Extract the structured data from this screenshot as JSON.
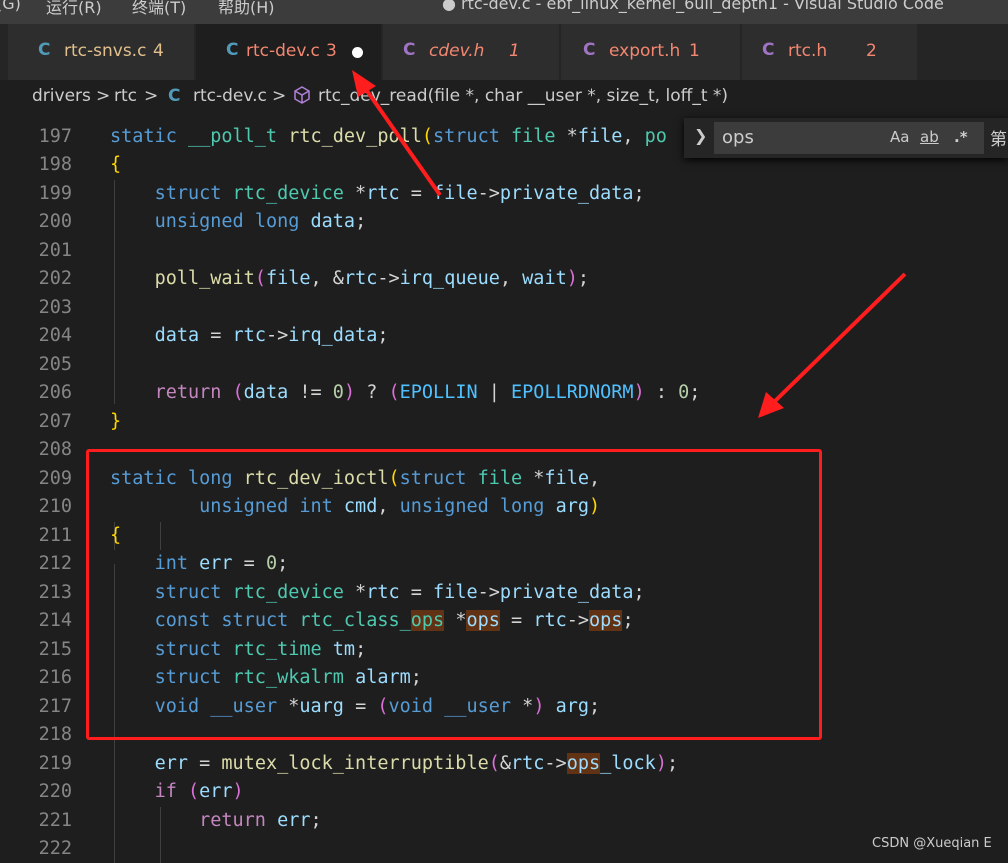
{
  "menubar": {
    "items": [
      "(G)",
      "运行(R)",
      "终端(T)",
      "帮助(H)"
    ],
    "window_title": "● rtc-dev.c - ebf_linux_kernel_6ull_depth1 - Visual Studio Code"
  },
  "tabs": [
    {
      "icon": "C",
      "label": "rtc-snvs.c",
      "count": "4",
      "color": "#e2c08d",
      "active": false,
      "italic": false
    },
    {
      "icon": "C",
      "label": "rtc-dev.c",
      "count": "3",
      "color": "#f48771",
      "active": true,
      "italic": false,
      "dirty": true
    },
    {
      "icon": "C",
      "label": "cdev.h",
      "count": "1",
      "color": "#f48771",
      "active": false,
      "italic": true
    },
    {
      "icon": "C",
      "label": "export.h",
      "count": "1",
      "color": "#f48771",
      "active": false,
      "italic": false
    },
    {
      "icon": "C",
      "label": "rtc.h",
      "count": "2",
      "color": "#f48771",
      "active": false,
      "italic": false
    }
  ],
  "breadcrumb": {
    "parts": [
      "drivers",
      ">",
      "rtc",
      ">",
      "C",
      "rtc-dev.c",
      ">",
      "rtc_dev_read(file *, char __user *, size_t, loff_t *)"
    ]
  },
  "find_widget": {
    "value": "ops",
    "match_case": "Aa",
    "whole_word": "ab",
    "regex": ".*",
    "result": "第"
  },
  "editor": {
    "lines": [
      {
        "n": "197"
      },
      {
        "n": "198"
      },
      {
        "n": "199"
      },
      {
        "n": "200"
      },
      {
        "n": "201"
      },
      {
        "n": "202"
      },
      {
        "n": "203"
      },
      {
        "n": "204"
      },
      {
        "n": "205"
      },
      {
        "n": "206"
      },
      {
        "n": "207"
      },
      {
        "n": "208"
      },
      {
        "n": "209"
      },
      {
        "n": "210"
      },
      {
        "n": "211"
      },
      {
        "n": "212"
      },
      {
        "n": "213"
      },
      {
        "n": "214"
      },
      {
        "n": "215"
      },
      {
        "n": "216"
      },
      {
        "n": "217"
      },
      {
        "n": "218"
      },
      {
        "n": "219"
      },
      {
        "n": "220"
      },
      {
        "n": "221"
      },
      {
        "n": "222"
      }
    ]
  },
  "watermark": "CSDN @Xueqian E",
  "colors": {
    "annotation": "#ff1d1d",
    "find_highlight": "#613214"
  }
}
